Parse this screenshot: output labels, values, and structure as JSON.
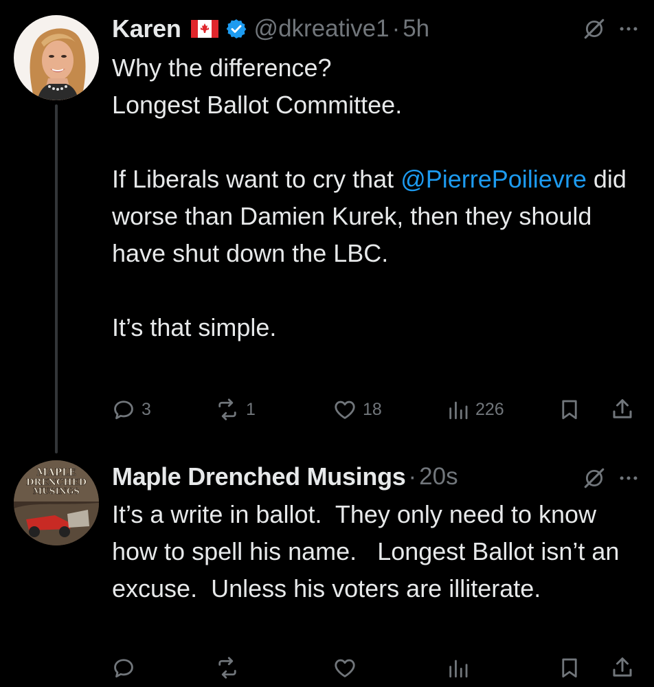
{
  "tweets": [
    {
      "author": {
        "name": "Karen",
        "handle": "@dkreative1",
        "flag_icon": "canada-flag-icon",
        "verified_icon": "verified-badge-icon"
      },
      "separator": "·",
      "time": "5h",
      "body": {
        "line1": "Why the difference?",
        "line2": "Longest Ballot Committee.",
        "para2_before_mention": "If Liberals want to cry that",
        "mention": "@PierrePoilievre",
        "para2_after_mention": " did worse than Damien Kurek, then they should have shut down the LBC.",
        "para3": "It’s that simple."
      },
      "metrics": {
        "replies": "3",
        "reposts": "1",
        "likes": "18",
        "views": "226"
      }
    },
    {
      "author": {
        "name": "Maple Drenched Musings",
        "avatar_text": [
          "MAPLE",
          "DRENCHED",
          "MUSINGS"
        ]
      },
      "separator": "·",
      "time": "20s",
      "body": {
        "text": "It’s a write in ballot.  They only need to know how to spell his name.   Longest Ballot isn’t an excuse.  Unless his voters are illiterate."
      },
      "metrics": {
        "replies": "",
        "reposts": "",
        "likes": "",
        "views": ""
      }
    }
  ],
  "icons": {
    "grok": "grok-icon",
    "more": "more-icon",
    "reply": "reply-icon",
    "repost": "repost-icon",
    "like": "like-icon",
    "views": "views-icon",
    "bookmark": "bookmark-icon",
    "share": "share-icon"
  },
  "colors": {
    "background": "#000000",
    "text_primary": "#e7e9ea",
    "text_secondary": "#71767b",
    "link": "#1d9bf0",
    "verified": "#1d9bf0",
    "thread_line": "#333639"
  }
}
